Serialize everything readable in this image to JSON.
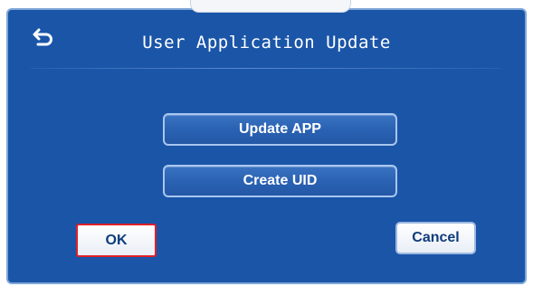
{
  "dialog": {
    "title": "User Application Update",
    "back_icon": "back-arrow-icon"
  },
  "menu": {
    "update_app_label": "Update APP",
    "create_uid_label": "Create UID"
  },
  "actions": {
    "ok_label": "OK",
    "cancel_label": "Cancel"
  },
  "colors": {
    "panel_background": "#1a55a8",
    "focus_border": "#e0202a",
    "button_text": "#0f3c7c"
  }
}
